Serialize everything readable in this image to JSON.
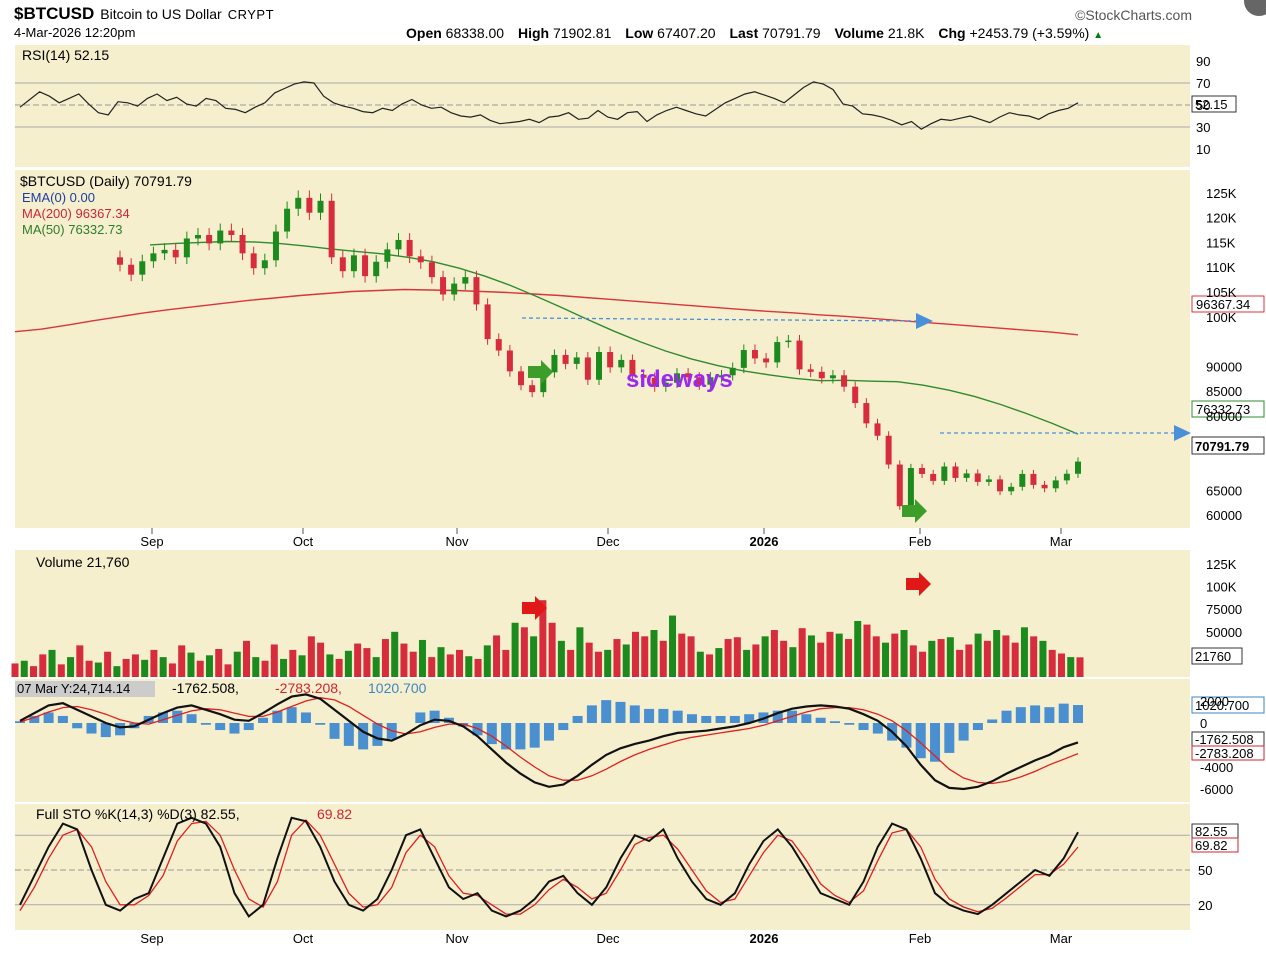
{
  "header": {
    "symbol": "$BTCUSD",
    "name": "Bitcoin to US Dollar",
    "exchange": "CRYPT",
    "datetime": "4-Mar-2026 12:20pm",
    "brand": "©StockCharts.com",
    "open_label": "Open",
    "open": "68338.00",
    "high_label": "High",
    "high": "71902.81",
    "low_label": "Low",
    "low": "67407.20",
    "last_label": "Last",
    "last": "70791.79",
    "volume_label": "Volume",
    "volume": "21.8K",
    "chg_label": "Chg",
    "chg": "+2453.79 (+3.59%)",
    "chg_arrow": "▲"
  },
  "colors": {
    "panel_bg": "#f6efce",
    "up": "#1d8a1d",
    "down": "#d62c3c",
    "ma200": "#d9353f",
    "ma50": "#2e8b2e",
    "macd_hist": "#4a8fcf",
    "annotation_arrow": "#4a90d9",
    "text_annotation": "#9b27f2"
  },
  "chart_data": [
    {
      "type": "line",
      "panel": "rsi",
      "legend": "RSI(14) 52.15",
      "last_value": "52.15",
      "ylim": [
        0,
        100
      ],
      "y_ticks": [
        "90",
        "70",
        "50",
        "30",
        "10"
      ],
      "reference_lines": [
        70,
        50,
        30
      ],
      "series": [
        {
          "values": [
            48,
            55,
            62,
            58,
            52,
            56,
            60,
            51,
            43,
            41,
            53,
            52,
            49,
            56,
            60,
            54,
            57,
            51,
            49,
            56,
            54,
            47,
            46,
            43,
            48,
            52,
            61,
            65,
            69,
            71,
            70,
            58,
            52,
            49,
            47,
            44,
            43,
            47,
            45,
            51,
            55,
            50,
            47,
            48,
            43,
            40,
            39,
            41,
            36,
            33,
            34,
            35,
            37,
            34,
            39,
            40,
            43,
            37,
            38,
            45,
            39,
            37,
            43,
            44,
            35,
            41,
            45,
            48,
            45,
            42,
            40,
            46,
            52,
            56,
            60,
            62,
            59,
            56,
            52,
            59,
            66,
            71,
            69,
            64,
            51,
            49,
            42,
            41,
            39,
            36,
            32,
            35,
            28,
            33,
            37,
            36,
            38,
            40,
            37,
            34,
            39,
            43,
            41,
            40,
            37,
            42,
            45,
            47,
            52
          ]
        }
      ],
      "annotations": [
        {
          "text": "52.15"
        }
      ]
    },
    {
      "type": "candlestick",
      "panel": "price",
      "legend": [
        "$BTCUSD (Daily) 70791.79",
        "EMA(0) 0.00",
        "MA(200) 96367.34",
        "MA(50) 76332.73"
      ],
      "x_ticks": [
        "Sep",
        "Oct",
        "Nov",
        "Dec",
        "2026",
        "Feb",
        "Mar"
      ],
      "y_ticks": [
        "125K",
        "120K",
        "115K",
        "110K",
        "105K",
        "100K",
        "95000",
        "90000",
        "85000",
        "80000",
        "75000",
        "70000",
        "65000",
        "60000"
      ],
      "ylim": [
        58000,
        128000
      ],
      "ohlc": [
        [
          112000,
          110500
        ],
        [
          110500,
          108500
        ],
        [
          108500,
          111200
        ],
        [
          111200,
          112800
        ],
        [
          112800,
          113500
        ],
        [
          113500,
          112000
        ],
        [
          112000,
          115800
        ],
        [
          115800,
          116500
        ],
        [
          116500,
          114800
        ],
        [
          114800,
          117400
        ],
        [
          117400,
          116500
        ],
        [
          116500,
          112800
        ],
        [
          112800,
          109800
        ],
        [
          109800,
          111400
        ],
        [
          111400,
          117200
        ],
        [
          117200,
          121800
        ],
        [
          121800,
          124000
        ],
        [
          124000,
          121000
        ],
        [
          121000,
          123400
        ],
        [
          123400,
          112000
        ],
        [
          112000,
          109200
        ],
        [
          109200,
          112400
        ],
        [
          112400,
          108200
        ],
        [
          108200,
          111100
        ],
        [
          111100,
          113600
        ],
        [
          113600,
          115500
        ],
        [
          115500,
          112200
        ],
        [
          112200,
          111000
        ],
        [
          111000,
          108000
        ],
        [
          108000,
          104500
        ],
        [
          104500,
          106700
        ],
        [
          106700,
          108000
        ],
        [
          108000,
          102500
        ],
        [
          102500,
          95500
        ],
        [
          95500,
          93200
        ],
        [
          93200,
          89000
        ],
        [
          89000,
          86200
        ],
        [
          86200,
          84800
        ],
        [
          84800,
          88800
        ],
        [
          88800,
          92300
        ],
        [
          92300,
          90500
        ],
        [
          90500,
          91800
        ],
        [
          91800,
          87300
        ],
        [
          87300,
          92900
        ],
        [
          92900,
          89800
        ],
        [
          89800,
          91300
        ],
        [
          91300,
          88300
        ],
        [
          88300,
          87700
        ],
        [
          87700,
          85900
        ],
        [
          85900,
          86700
        ],
        [
          86700,
          88600
        ],
        [
          88600,
          87800
        ],
        [
          87800,
          86300
        ],
        [
          86300,
          87800
        ],
        [
          87800,
          88200
        ],
        [
          88200,
          89700
        ],
        [
          89700,
          93300
        ],
        [
          93300,
          91600
        ],
        [
          91600,
          90800
        ],
        [
          90800,
          94900
        ],
        [
          94900,
          95200
        ],
        [
          95200,
          89400
        ],
        [
          89400,
          88900
        ],
        [
          88900,
          87600
        ],
        [
          87600,
          88200
        ],
        [
          88200,
          85900
        ],
        [
          85900,
          82600
        ],
        [
          82600,
          78500
        ],
        [
          78500,
          76000
        ],
        [
          76000,
          70200
        ],
        [
          70200,
          61800
        ],
        [
          61800,
          69500
        ],
        [
          69500,
          68300
        ],
        [
          68300,
          66900
        ],
        [
          66900,
          69800
        ],
        [
          69800,
          67500
        ],
        [
          67500,
          68400
        ],
        [
          68400,
          66700
        ],
        [
          66700,
          67200
        ],
        [
          67200,
          64800
        ],
        [
          64800,
          65700
        ],
        [
          65700,
          68300
        ],
        [
          68300,
          66100
        ],
        [
          66100,
          65400
        ],
        [
          65400,
          67000
        ],
        [
          67000,
          68338
        ],
        [
          68338,
          70791
        ]
      ],
      "ma200": [
        97000,
        97500,
        98300,
        99200,
        100000,
        100800,
        101500,
        102100,
        102700,
        103300,
        103800,
        104300,
        104700,
        105100,
        105300,
        105500,
        105400,
        105300,
        105100,
        104900,
        104600,
        104300,
        103900,
        103500,
        103100,
        102700,
        102300,
        101900,
        101500,
        101100,
        100800,
        100400,
        100100,
        99700,
        99300,
        98900,
        98500,
        98100,
        97700,
        97300,
        96900,
        96367
      ],
      "ma50": [
        114500,
        114800,
        115000,
        115200,
        115100,
        114800,
        114300,
        113700,
        113200,
        112700,
        112000,
        111100,
        109800,
        108200,
        106300,
        104100,
        101800,
        99400,
        97100,
        95000,
        93100,
        91500,
        90200,
        89100,
        88300,
        87600,
        87100,
        87200,
        87000,
        86900,
        86200,
        85200,
        83900,
        82300,
        80500,
        78500,
        76332
      ],
      "annotations": [
        {
          "text": "sideways"
        },
        {
          "text": "96367.34"
        },
        {
          "text": "76332.73"
        },
        {
          "text": "70791.79"
        }
      ]
    },
    {
      "type": "bar",
      "panel": "volume",
      "legend": "Volume 21,760",
      "last_value": "21760",
      "y_ticks": [
        "125K",
        "100K",
        "75000",
        "50000"
      ],
      "ylim": [
        0,
        135000
      ],
      "values": [
        15000,
        18000,
        12000,
        25000,
        30000,
        14000,
        22000,
        35000,
        18000,
        16000,
        28000,
        12000,
        20000,
        25000,
        19000,
        30000,
        22000,
        15000,
        35000,
        27000,
        18000,
        24000,
        31000,
        14000,
        28000,
        40000,
        22000,
        18000,
        36000,
        20000,
        30000,
        24000,
        45000,
        38000,
        25000,
        20000,
        29000,
        37000,
        32000,
        22000,
        42000,
        50000,
        37000,
        28000,
        41000,
        22000,
        33000,
        25000,
        30000,
        23000,
        20000,
        35000,
        46000,
        30000,
        60000,
        55000,
        45000,
        85000,
        60000,
        40000,
        30000,
        55000,
        38000,
        28000,
        30000,
        42000,
        36000,
        50000,
        45000,
        52000,
        40000,
        68000,
        48000,
        45000,
        28000,
        25000,
        32000,
        42000,
        44000,
        30000,
        36000,
        45000,
        52000,
        40000,
        33000,
        54000,
        46000,
        38000,
        50000,
        48000,
        42000,
        62000,
        58000,
        45000,
        38000,
        48000,
        52000,
        35000,
        28000,
        40000,
        42000,
        44000,
        30000,
        36000,
        48000,
        40000,
        52000,
        46000,
        38000,
        55000,
        45000,
        40000,
        30000,
        26000,
        22000,
        21760
      ],
      "annotations": []
    },
    {
      "type": "line",
      "panel": "macd",
      "legend": [
        "07 Mar Y:24,714.14",
        "-1762.508",
        "-2783.208",
        "1020.700"
      ],
      "y_ticks": [
        "2000",
        "0",
        "-4000",
        "-6000"
      ],
      "ylim": [
        -7000,
        3000
      ],
      "series": [
        {
          "values": [
            200,
            900,
            1600,
            1800,
            1200,
            600,
            0,
            -400,
            -300,
            300,
            900,
            1400,
            1600,
            1200,
            800,
            300,
            200,
            900,
            1700,
            2400,
            2600,
            2200,
            1200,
            200,
            -800,
            -1400,
            -1600,
            -1000,
            -200,
            300,
            200,
            -300,
            -1200,
            -2400,
            -3600,
            -4600,
            -5400,
            -5800,
            -5600,
            -4800,
            -3800,
            -2900,
            -2300,
            -1900,
            -1600,
            -1200,
            -900,
            -800,
            -700,
            -500,
            -300,
            0,
            400,
            900,
            1300,
            1500,
            1600,
            1500,
            1300,
            800,
            200,
            -800,
            -2100,
            -3800,
            -5200,
            -5900,
            -6000,
            -5800,
            -5300,
            -4600,
            -4000,
            -3400,
            -2900,
            -2200,
            -1762
          ]
        },
        {
          "values": [
            100,
            500,
            1000,
            1400,
            1500,
            1200,
            800,
            300,
            0,
            -100,
            300,
            700,
            1100,
            1300,
            1200,
            900,
            600,
            600,
            1000,
            1500,
            2000,
            2300,
            2100,
            1500,
            700,
            -100,
            -700,
            -1000,
            -800,
            -400,
            -100,
            -100,
            -500,
            -1200,
            -2100,
            -3100,
            -4000,
            -4800,
            -5200,
            -5200,
            -4800,
            -4200,
            -3500,
            -2900,
            -2400,
            -2000,
            -1600,
            -1300,
            -1100,
            -900,
            -700,
            -500,
            -200,
            200,
            600,
            1000,
            1300,
            1400,
            1400,
            1200,
            800,
            200,
            -700,
            -1800,
            -3000,
            -4200,
            -5000,
            -5400,
            -5500,
            -5300,
            -4900,
            -4400,
            -3800,
            -3300,
            -2783
          ]
        }
      ],
      "histogram_last": 1020.7,
      "annotations": [
        {
          "text": "1020.700"
        },
        {
          "text": "-1762.508"
        },
        {
          "text": "-2783.208"
        }
      ]
    },
    {
      "type": "line",
      "panel": "stochastic",
      "legend": [
        "Full STO %K(14,3) %D(3) 82.55,",
        "69.82"
      ],
      "y_ticks": [
        "80",
        "50",
        "20"
      ],
      "ylim": [
        0,
        100
      ],
      "reference_lines": [
        80,
        50,
        20
      ],
      "series": [
        {
          "values": [
            20,
            45,
            70,
            90,
            85,
            50,
            20,
            15,
            25,
            30,
            60,
            90,
            95,
            90,
            70,
            30,
            10,
            20,
            60,
            95,
            92,
            70,
            40,
            20,
            15,
            25,
            50,
            80,
            85,
            60,
            35,
            25,
            30,
            15,
            10,
            15,
            25,
            40,
            45,
            30,
            20,
            35,
            60,
            80,
            75,
            85,
            60,
            40,
            25,
            20,
            30,
            55,
            75,
            85,
            70,
            50,
            30,
            25,
            20,
            40,
            70,
            90,
            85,
            60,
            30,
            20,
            15,
            12,
            20,
            30,
            40,
            50,
            45,
            60,
            82.55
          ]
        },
        {
          "values": [
            15,
            35,
            60,
            80,
            85,
            70,
            40,
            20,
            20,
            28,
            45,
            75,
            90,
            92,
            80,
            50,
            25,
            18,
            40,
            80,
            93,
            80,
            55,
            30,
            18,
            20,
            35,
            65,
            80,
            70,
            45,
            30,
            28,
            20,
            12,
            12,
            20,
            33,
            42,
            35,
            25,
            30,
            50,
            72,
            78,
            80,
            68,
            50,
            32,
            22,
            25,
            45,
            65,
            80,
            75,
            58,
            38,
            28,
            22,
            32,
            58,
            82,
            85,
            70,
            42,
            25,
            18,
            14,
            17,
            26,
            36,
            46,
            46,
            55,
            69.82
          ]
        }
      ],
      "annotations": [
        {
          "text": "82.55"
        },
        {
          "text": "69.82"
        }
      ]
    }
  ],
  "panels": {
    "rsi_label": "RSI(14) 52.15",
    "rsi_value": "52.15",
    "price_legend_title": "$BTCUSD (Daily) 70791.79",
    "ema_label": "EMA(0) 0.00",
    "ma200_label": "MA(200) 96367.34",
    "ma50_label": "MA(50) 76332.73",
    "sideways": "sideways",
    "ma200_value": "96367.34",
    "ma50_value": "76332.73",
    "last_value": "70791.79",
    "volume_label": "Volume 21,760",
    "volume_value": "21760",
    "macd_prefix": "07 Mar Y:24,714.14",
    "macd_v1": "-1762.508,",
    "macd_v2": "-2783.208,",
    "macd_v3": "1020.700",
    "macd_box1": "1020.700",
    "macd_box2": "-1762.508",
    "macd_box3": "-2783.208",
    "sto_label": "Full STO %K(14,3) %D(3) 82.55,",
    "sto_d": "69.82",
    "sto_k_value": "82.55",
    "sto_d_value": "69.82"
  },
  "axes": {
    "rsi_ticks": [
      "90",
      "70",
      "50",
      "30",
      "10"
    ],
    "price_ticks": [
      "125K",
      "120K",
      "115K",
      "110K",
      "105K",
      "100K",
      "95000",
      "90000",
      "85000",
      "80000",
      "75000",
      "70000",
      "65000",
      "60000"
    ],
    "volume_ticks": [
      "125K",
      "100K",
      "75000",
      "50000"
    ],
    "macd_ticks": [
      "2000",
      "0",
      "-4000",
      "-6000"
    ],
    "sto_ticks": [
      "80",
      "50",
      "20"
    ],
    "months": [
      "Sep",
      "Oct",
      "Nov",
      "Dec",
      "2026",
      "Feb",
      "Mar"
    ]
  }
}
